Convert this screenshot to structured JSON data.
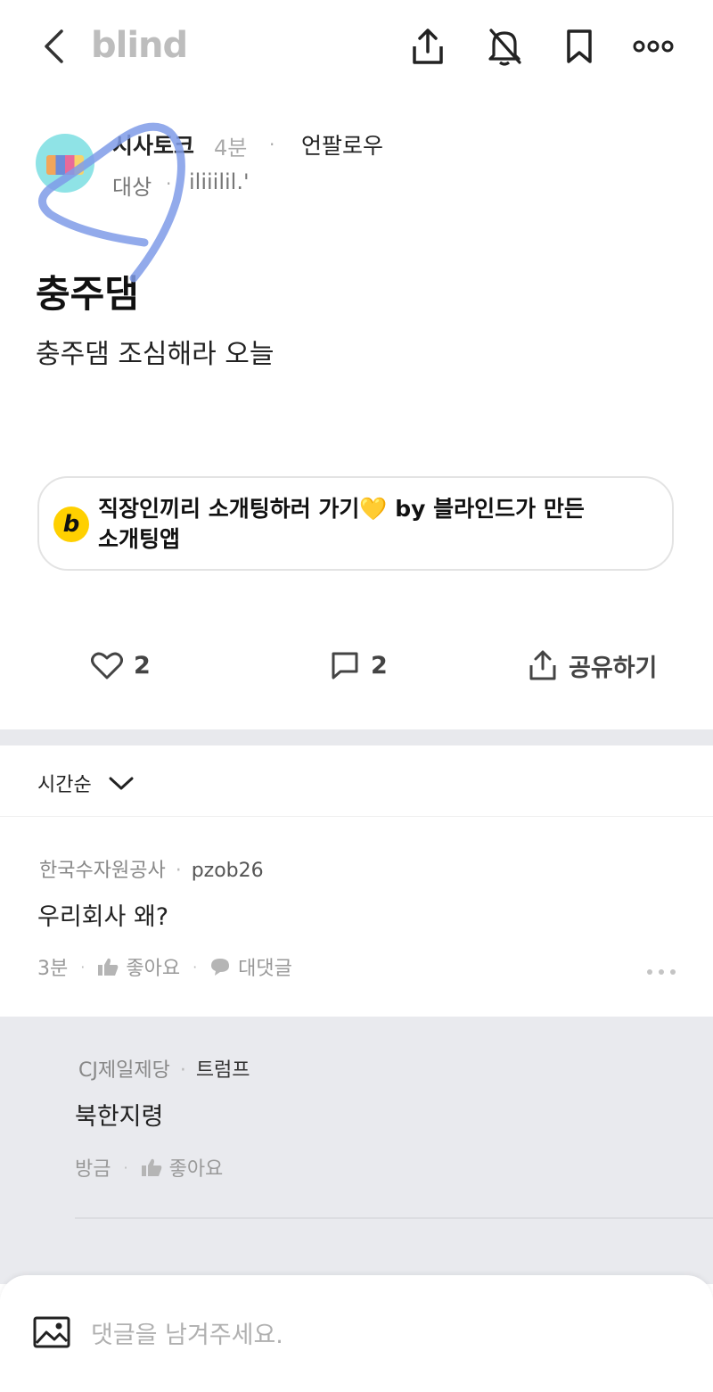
{
  "app": {
    "logo": "blind"
  },
  "topbar": {
    "icons": [
      "back-icon",
      "share-icon",
      "bell-off-icon",
      "bookmark-icon",
      "more-icon"
    ]
  },
  "post": {
    "author": "시사토크",
    "time": "4분",
    "dot": "·",
    "follow_label": "언팔로우",
    "company": "대상",
    "handle": "iliiilil.'",
    "title": "충주댐",
    "body": "충주댐 조심해라 오늘"
  },
  "promo": {
    "logo_letter": "b",
    "text_line1": "직장인끼리 소개팅하러 가기",
    "emoji": "💛",
    "text_line1_suffix": " by 블라인드가 만든",
    "text_line2": "소개팅앱"
  },
  "stats": {
    "likes": "2",
    "comments": "2",
    "share_label": "공유하기"
  },
  "sort": {
    "label": "시간순"
  },
  "comments": [
    {
      "company": "한국수자원공사",
      "handle": "pzob26",
      "text": "우리회사 왜?",
      "time": "3분",
      "like_label": "좋아요",
      "reply_label": "대댓글"
    }
  ],
  "replies": [
    {
      "company": "CJ제일제당",
      "handle": "트럼프",
      "text": "북한지령",
      "time": "방금",
      "like_label": "좋아요"
    }
  ],
  "composer": {
    "placeholder": "댓글을 남겨주세요."
  },
  "colors": {
    "accent_scribble": "#7f9be8",
    "promo_logo": "#ffd000",
    "divider": "#e8e9ed"
  }
}
